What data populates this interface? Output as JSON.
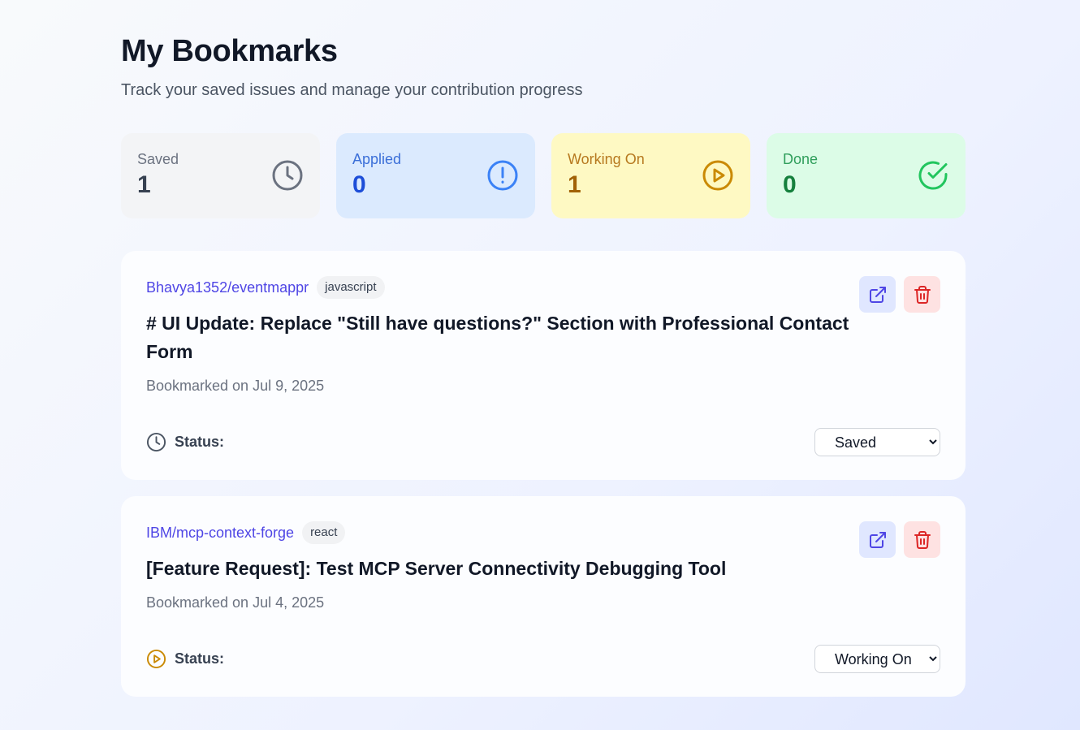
{
  "page": {
    "title": "My Bookmarks",
    "subtitle": "Track your saved issues and manage your contribution progress"
  },
  "stats": [
    {
      "label": "Saved",
      "value": "1",
      "icon": "clock-icon",
      "color": "#6b7280"
    },
    {
      "label": "Applied",
      "value": "0",
      "icon": "alert-circle-icon",
      "color": "#3b82f6"
    },
    {
      "label": "Working On",
      "value": "1",
      "icon": "play-circle-icon",
      "color": "#ca8a04"
    },
    {
      "label": "Done",
      "value": "0",
      "icon": "check-circle-icon",
      "color": "#22c55e"
    }
  ],
  "bookmarks": [
    {
      "repo": "Bhavya1352/eventmappr",
      "language": "javascript",
      "title": "# UI Update: Replace \"Still have questions?\" Section with Professional Contact Form",
      "date": "Bookmarked on Jul 9, 2025",
      "status_label": "Status:",
      "status": "Saved",
      "status_icon": "clock-icon"
    },
    {
      "repo": "IBM/mcp-context-forge",
      "language": "react",
      "title": "[Feature Request]: Test MCP Server Connectivity Debugging Tool",
      "date": "Bookmarked on Jul 4, 2025",
      "status_label": "Status:",
      "status": "Working On",
      "status_icon": "play-circle-icon"
    }
  ],
  "status_options": [
    "Saved",
    "Applied",
    "Working On",
    "Done"
  ],
  "colors": {
    "accent": "#4f46e5",
    "danger": "#dc2626"
  }
}
